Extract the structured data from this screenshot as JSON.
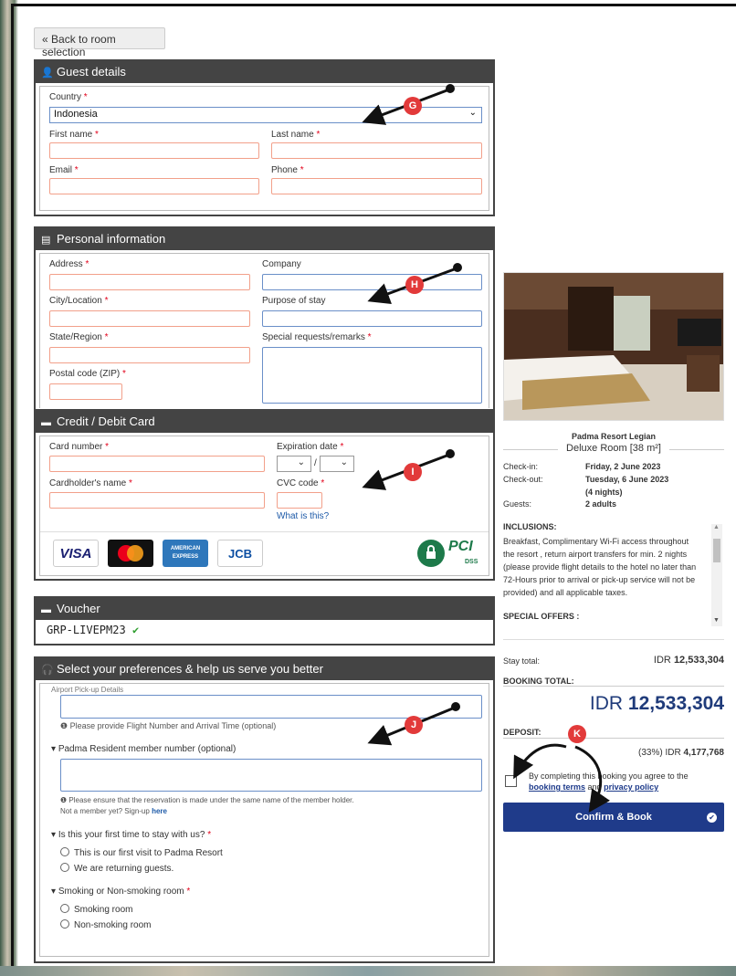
{
  "nav": {
    "back_label": "Back to room selection"
  },
  "guest": {
    "title": "Guest details",
    "country_label": "Country",
    "country_value": "Indonesia",
    "first_name_label": "First name",
    "last_name_label": "Last name",
    "email_label": "Email",
    "phone_label": "Phone"
  },
  "personal": {
    "title": "Personal information",
    "address_label": "Address",
    "company_label": "Company",
    "city_label": "City/Location",
    "purpose_label": "Purpose of stay",
    "state_label": "State/Region",
    "special_label": "Special requests/remarks",
    "postal_label": "Postal code (ZIP)"
  },
  "card": {
    "title": "Credit / Debit Card",
    "number_label": "Card number",
    "expiry_label": "Expiration date",
    "expiry_sep": "/",
    "holder_label": "Cardholder's name",
    "cvc_label": "CVC code",
    "what_is_this": "What is this?",
    "logos": [
      "VISA",
      "AMERICAN EXPRESS",
      "JCB"
    ],
    "pci_text": "PCI",
    "dss_text": "DSS"
  },
  "voucher": {
    "title": "Voucher",
    "code": "GRP-LIVEPM23"
  },
  "prefs": {
    "title": "Select your preferences & help us serve you better",
    "airport_label": "Airport Pick-up Details",
    "airport_hint": "Please provide Flight Number and Arrival Time (optional)",
    "member_label": "Padma Resident member number (optional)",
    "member_hint": "Please ensure that the reservation is made under the same name of the member holder.",
    "not_member": "Not a member yet? Sign-up",
    "signup_link": "here",
    "first_time_label": "Is this your first time to stay with us?",
    "first_time_options": [
      "This is our first visit to Padma Resort",
      "We are returning guests."
    ],
    "smoking_label": "Smoking or Non-smoking room",
    "smoking_options": [
      "Smoking room",
      "Non-smoking room"
    ]
  },
  "summary": {
    "hotel_name": "Padma Resort Legian",
    "room": "Deluxe Room [38 m²]",
    "checkin_label": "Check-in:",
    "checkin_value": "Friday, 2 June 2023",
    "checkout_label": "Check-out:",
    "checkout_value": "Tuesday, 6 June 2023",
    "nights": "(4 nights)",
    "guests_label": "Guests:",
    "guests_value": "2 adults",
    "inclusions_title": "INCLUSIONS:",
    "inclusions_lines": [
      "Breakfast, Complimentary Wi-Fi access throughout",
      "the resort , return airport transfers for min. 2 nights",
      "(please provide flight details to the hotel no later than",
      "72-Hours prior to arrival or pick-up service will not be",
      "provided) and all applicable taxes."
    ],
    "special_offers_title": "SPECIAL OFFERS :",
    "stay_total_label": "Stay total:",
    "stay_total_currency": "IDR",
    "stay_total_value": "12,533,304",
    "booking_total_label": "BOOKING TOTAL:",
    "booking_total_currency": "IDR",
    "booking_total_value": "12,533,304",
    "deposit_label": "DEPOSIT:",
    "deposit_pct": "(33%) IDR",
    "deposit_value": "4,177,768",
    "agree_text_1": "By completing this booking you agree to the",
    "agree_link_1": "booking terms",
    "agree_and": "and",
    "agree_link_2": "privacy policy",
    "confirm_label": "Confirm & Book"
  },
  "markers": [
    "G",
    "H",
    "I",
    "J",
    "K"
  ]
}
